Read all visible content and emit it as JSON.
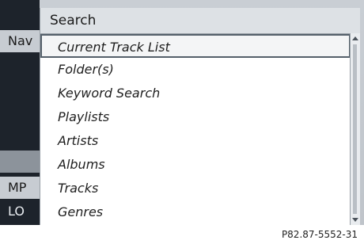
{
  "left_panel": {
    "items": [
      "Nav",
      "MP",
      "LO"
    ]
  },
  "popup": {
    "title": "Search",
    "items": [
      "Current Track List",
      "Folder(s)",
      "Keyword Search",
      "Playlists",
      "Artists",
      "Albums",
      "Tracks",
      "Genres"
    ],
    "selected_index": 0
  },
  "footer": {
    "ref": "P82.87-5552-31"
  }
}
